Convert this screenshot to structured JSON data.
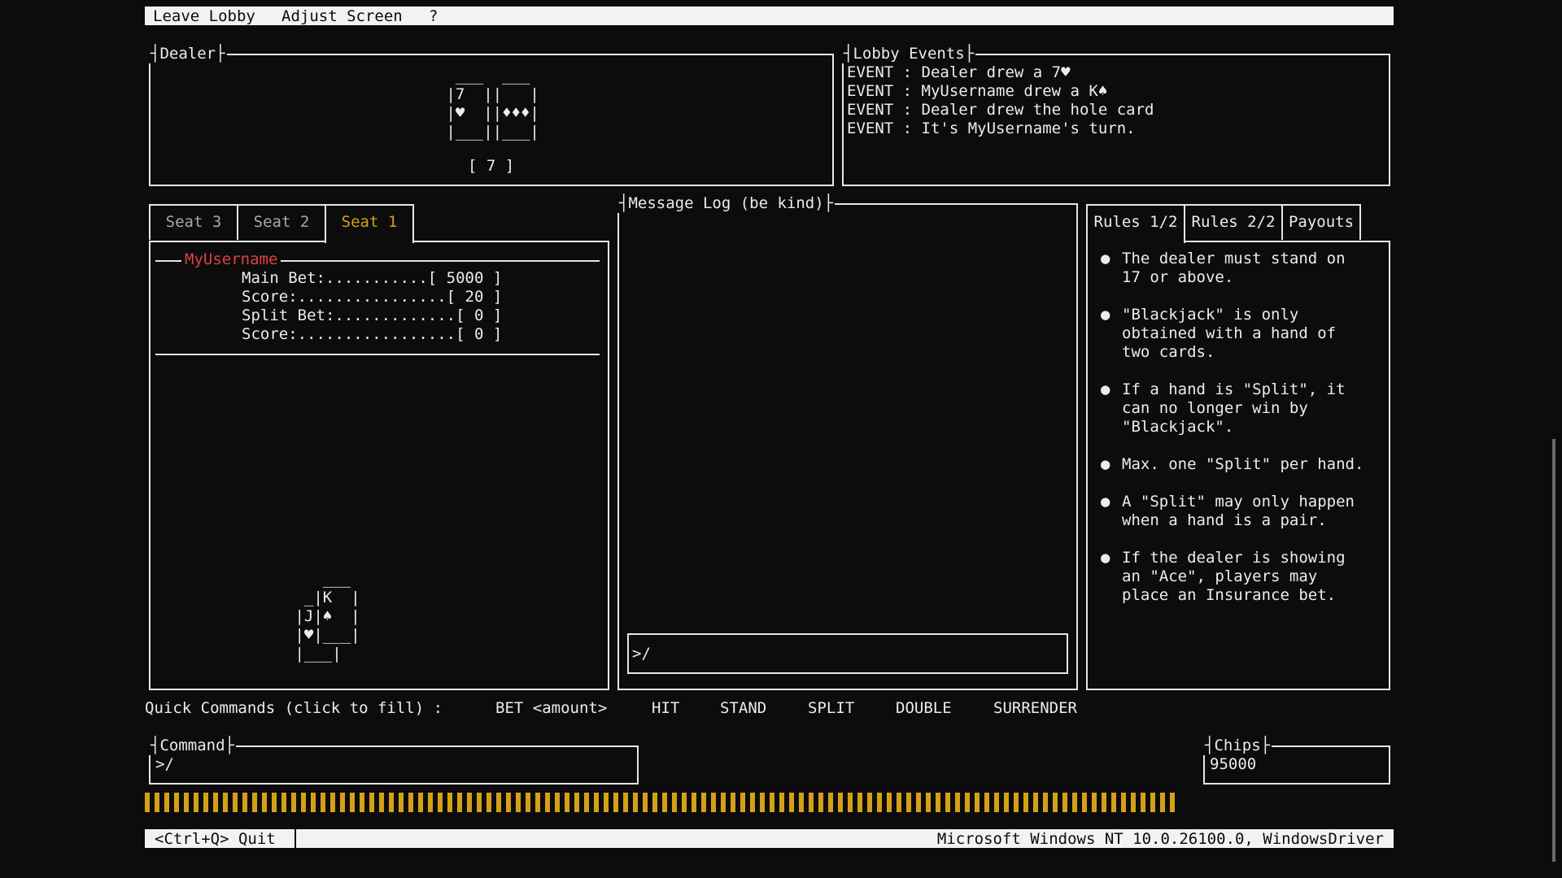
{
  "menu": {
    "leave": "Leave Lobby",
    "adjust": "Adjust Screen",
    "help": "?"
  },
  "dealer": {
    "title": "Dealer",
    "cards_art": [
      "  ___  ___",
      " |7  ||   |",
      " |♥  ||♦♦♦|",
      " |___||___|"
    ],
    "score": "[ 7 ]"
  },
  "lobby_events": {
    "title": "Lobby Events",
    "items": [
      "EVENT : Dealer drew a 7♥",
      "EVENT : MyUsername drew a K♠",
      "EVENT : Dealer drew the hole card",
      "EVENT : It's MyUsername's turn."
    ]
  },
  "seats": {
    "tabs": [
      "Seat 3",
      "Seat 2",
      "Seat 1"
    ],
    "active": "Seat 1",
    "player_name": "MyUsername",
    "stats": [
      "Main Bet:...........[ 5000 ]",
      "Score:................[ 20 ]",
      "Split Bet:.............[ 0 ]",
      "Score:.................[ 0 ]"
    ],
    "cards_art": [
      "    ___",
      "  _|K  |",
      " |J|♠  |",
      " |♥|___|",
      " |___|"
    ]
  },
  "message_log": {
    "title": "Message Log (be kind)",
    "input_value": ">/"
  },
  "rules": {
    "tabs": [
      "Rules 1/2",
      "Rules 2/2",
      "Payouts"
    ],
    "active": "Rules 1/2",
    "items": [
      "The dealer must stand on\n17 or above.",
      "\"Blackjack\" is only\nobtained with a hand of\ntwo cards.",
      "If a hand is \"Split\", it\ncan no longer win by\n\"Blackjack\".",
      "Max. one \"Split\" per hand.",
      "A \"Split\" may only happen\nwhen a hand is a pair.",
      "If the dealer is showing\nan \"Ace\", players may\nplace an Insurance bet."
    ]
  },
  "quick_commands": {
    "label": "Quick Commands (click to fill) :",
    "items": [
      "BET <amount>",
      "HIT",
      "STAND",
      "SPLIT",
      "DOUBLE",
      "SURRENDER"
    ]
  },
  "command": {
    "title": "Command",
    "value": ">/"
  },
  "chips": {
    "title": "Chips",
    "value": "95000"
  },
  "status": {
    "quit": "<Ctrl+Q> Quit",
    "system": "Microsoft Windows NT 10.0.26100.0, WindowsDriver"
  },
  "colors": {
    "accent_yellow": "#d4a017",
    "username_red": "#e04040",
    "background": "#0c0c0c",
    "foreground": "#ececec"
  }
}
